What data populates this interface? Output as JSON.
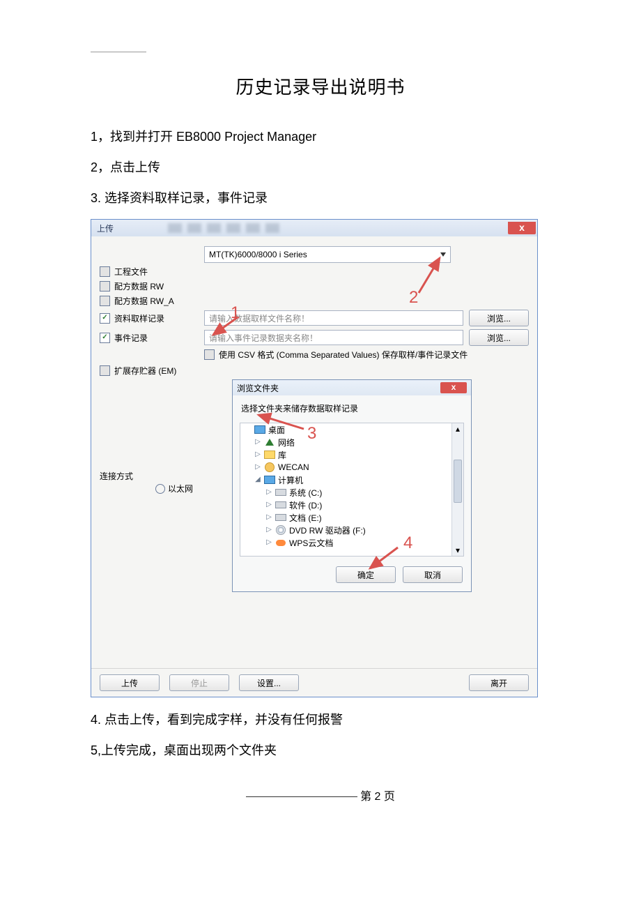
{
  "doc": {
    "title": "历史记录导出说明书",
    "step1": "1，找到并打开 EB8000 Project Manager",
    "step2": "2，点击上传",
    "step3": "3. 选择资料取样记录，事件记录",
    "step4": "4. 点击上传，看到完成字样，并没有任何报警",
    "step5": "5,上传完成，桌面出现两个文件夹",
    "footer": "第 2 页"
  },
  "main": {
    "title": "上传",
    "series_selected": "MT(TK)6000/8000 i Series",
    "checks": {
      "project": "工程文件",
      "rw": "配方数据 RW",
      "rwa": "配方数据 RW_A",
      "sample": "资料取样记录",
      "event": "事件记录",
      "em": "扩展存贮器 (EM)"
    },
    "placeholder_sample": "请输入数据取样文件名称！",
    "placeholder_event": "请输入事件记录数据夹名称！",
    "csv_label": "使用 CSV 格式 (Comma Separated Values) 保存取样/事件记录文件",
    "browse": "浏览...",
    "conn_label": "连接方式",
    "radio_eth": "以太网",
    "btn_upload": "上传",
    "btn_stop": "停止",
    "btn_settings": "设置...",
    "btn_leave": "离开"
  },
  "browse": {
    "title": "浏览文件夹",
    "msg": "选择文件夹来储存数据取样记录",
    "tree": {
      "desktop": "桌面",
      "network": "网络",
      "libs": "库",
      "wecan": "WECAN",
      "computer": "计算机",
      "cdrive": "系统 (C:)",
      "ddrive": "软件 (D:)",
      "edrive": "文档 (E:)",
      "fdrive": "DVD RW 驱动器 (F:)",
      "wps": "WPS云文档"
    },
    "ok": "确定",
    "cancel": "取消"
  },
  "ann": {
    "a1": "1",
    "a2": "2",
    "a3": "3",
    "a4": "4"
  }
}
